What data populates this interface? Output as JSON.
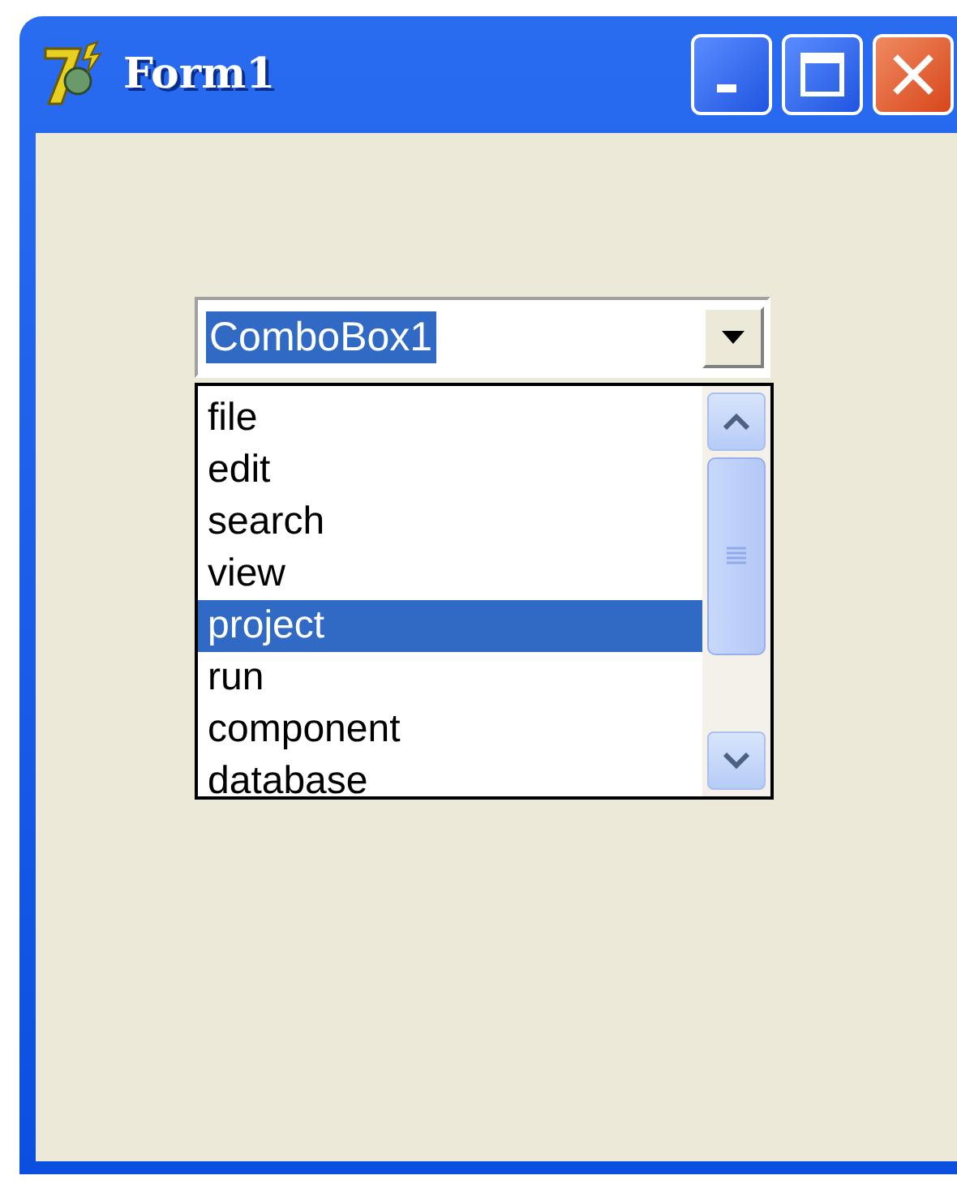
{
  "window": {
    "title": "Form1"
  },
  "combo": {
    "value": "ComboBox1"
  },
  "list": {
    "items": [
      {
        "label": "file",
        "selected": false
      },
      {
        "label": "edit",
        "selected": false
      },
      {
        "label": "search",
        "selected": false
      },
      {
        "label": "view",
        "selected": false
      },
      {
        "label": "project",
        "selected": true
      },
      {
        "label": "run",
        "selected": false
      },
      {
        "label": "component",
        "selected": false
      },
      {
        "label": "database",
        "selected": false
      }
    ]
  }
}
